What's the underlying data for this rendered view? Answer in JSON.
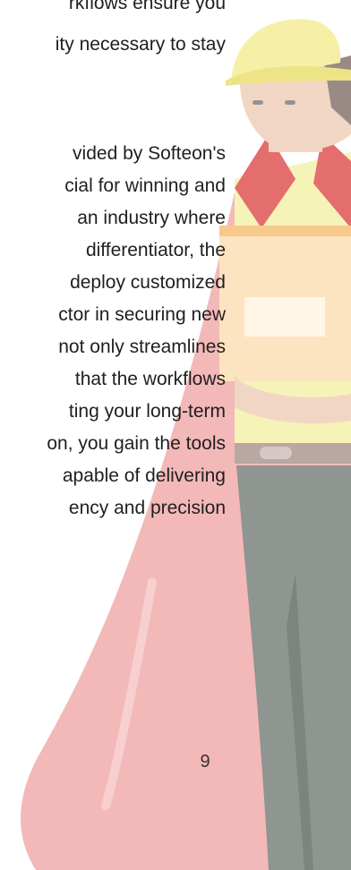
{
  "paragraph_1": {
    "lines": [
      "rkflows ensure you",
      "ity necessary to stay"
    ]
  },
  "paragraph_2": {
    "lines": [
      "vided by Softeon's",
      "cial for winning and",
      "an industry where",
      "differentiator, the",
      "deploy customized",
      "ctor in securing new",
      "not only streamlines",
      "that the workflows",
      "ting your long-term",
      "on, you gain the tools",
      "apable of delivering",
      "ency and precision"
    ]
  },
  "page_number": "9",
  "colors": {
    "cape": "#f2b6b6",
    "cape_dark": "#e79c9c",
    "hat": "#f5f0a6",
    "skin": "#f2d6c4",
    "shirt": "#f6f3b8",
    "collar": "#e46d6d",
    "box": "#fde4c0",
    "box_dark": "#f7c98a",
    "pants": "#8f9590",
    "belt": "#b9a7a4"
  }
}
